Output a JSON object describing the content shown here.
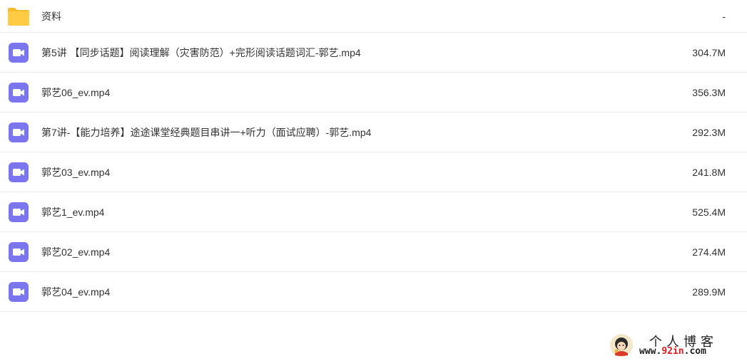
{
  "files": [
    {
      "type": "folder",
      "icon": "folder-icon",
      "name": "资料",
      "size": "-"
    },
    {
      "type": "video",
      "icon": "video-file-icon",
      "name": "第5讲 【同步话题】阅读理解（灾害防范）+完形阅读话题词汇-郭艺.mp4",
      "size": "304.7M"
    },
    {
      "type": "video",
      "icon": "video-file-icon",
      "name": "郭艺06_ev.mp4",
      "size": "356.3M"
    },
    {
      "type": "video",
      "icon": "video-file-icon",
      "name": "第7讲-【能力培养】途途课堂经典题目串讲一+听力（面试应聘）-郭艺.mp4",
      "size": "292.3M"
    },
    {
      "type": "video",
      "icon": "video-file-icon",
      "name": "郭艺03_ev.mp4",
      "size": "241.8M"
    },
    {
      "type": "video",
      "icon": "video-file-icon",
      "name": "郭艺1_ev.mp4",
      "size": "525.4M"
    },
    {
      "type": "video",
      "icon": "video-file-icon",
      "name": "郭艺02_ev.mp4",
      "size": "274.4M"
    },
    {
      "type": "video",
      "icon": "video-file-icon",
      "name": "郭艺04_ev.mp4",
      "size": "289.9M"
    }
  ],
  "watermark": {
    "title": "个人博客",
    "url_prefix": "www.",
    "url_highlight": "92in",
    "url_suffix": ".com",
    "icon": "mascot-logo-icon"
  },
  "colors": {
    "folder": "#FFCB45",
    "video_icon": "#7B75F0",
    "text": "#333333",
    "divider": "#EEEEEE",
    "watermark_highlight": "#E0191A"
  }
}
